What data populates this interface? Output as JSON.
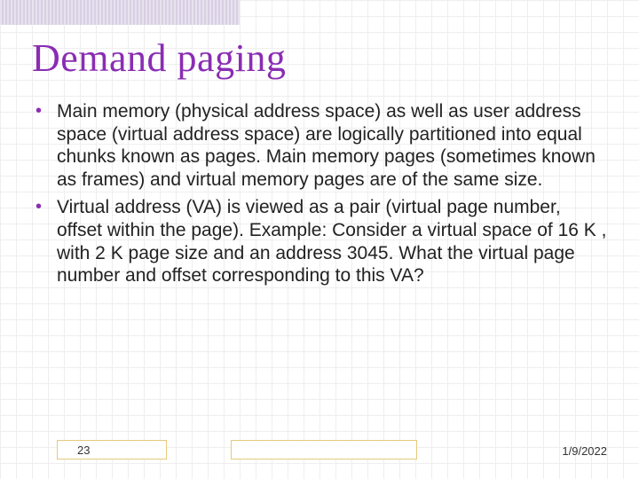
{
  "slide": {
    "title": "Demand paging",
    "bullets": [
      "Main memory (physical address space) as well as user address space (virtual address space) are logically partitioned into equal chunks known as pages. Main memory pages (sometimes known as frames)  and virtual memory pages are of the same size.",
      "Virtual address (VA) is viewed as a pair (virtual page number, offset within the page). Example: Consider a virtual space of 16 K , with 2 K page size and an address 3045. What the virtual page number and offset corresponding to this VA?"
    ]
  },
  "footer": {
    "page_number": "23",
    "date": "1/9/2022"
  }
}
